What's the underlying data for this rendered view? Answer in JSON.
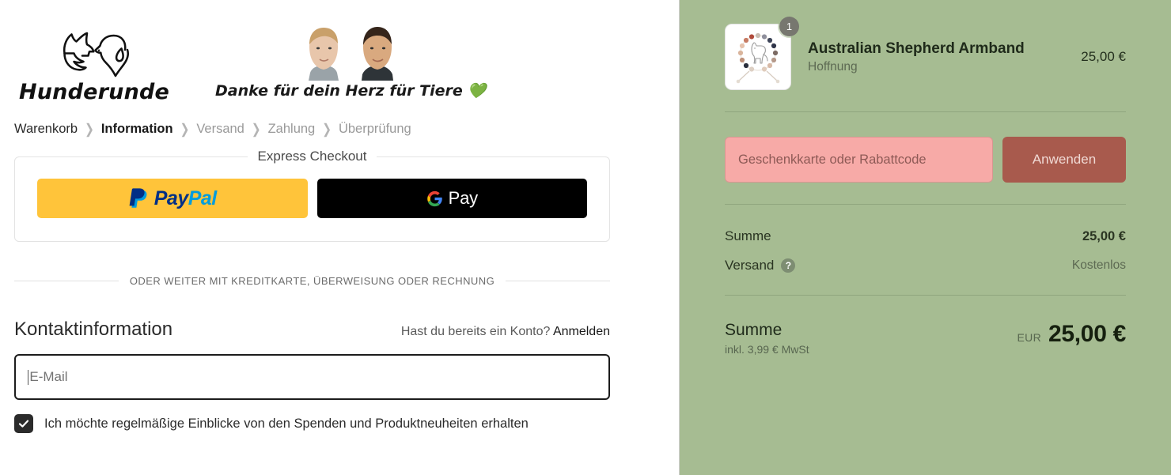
{
  "brand": {
    "logo_word": "Hunderunde",
    "logo_icon": "two-dog-heads-logo",
    "tagline": "Danke für dein Herz für Tiere",
    "tagline_heart": "💚"
  },
  "breadcrumb": {
    "items": [
      {
        "label": "Warenkorb",
        "state": "link"
      },
      {
        "label": "Information",
        "state": "current"
      },
      {
        "label": "Versand",
        "state": "upcoming"
      },
      {
        "label": "Zahlung",
        "state": "upcoming"
      },
      {
        "label": "Überprüfung",
        "state": "upcoming"
      }
    ],
    "separator": "❯"
  },
  "express": {
    "legend": "Express Checkout",
    "paypal": {
      "pay": "Pay",
      "pal": "Pal",
      "icon": "paypal-logo"
    },
    "gpay": {
      "label": "Pay",
      "icon": "google-g-logo"
    }
  },
  "divider": {
    "text": "ODER WEITER MIT KREDITKARTE, ÜBERWEISUNG ODER RECHNUNG"
  },
  "contact": {
    "title": "Kontaktinformation",
    "login_prompt": "Hast du bereits ein Konto?",
    "login_link": "Anmelden",
    "email_placeholder": "E-Mail",
    "email_value": "",
    "newsletter_label": "Ich möchte regelmäßige Einblicke von den Spenden und Produktneuheiten erhalten",
    "newsletter_checked": "true"
  },
  "summary": {
    "line_item": {
      "title": "Australian Shepherd Armband",
      "variant": "Hoffnung",
      "quantity": "1",
      "price": "25,00 €",
      "thumb_icon": "beaded-bracelet-dog-charm"
    },
    "discount": {
      "placeholder": "Geschenkkarte oder Rabattcode",
      "value": "",
      "apply_label": "Anwenden"
    },
    "totals": [
      {
        "label": "Summe",
        "value": "25,00 €",
        "muted": "false",
        "help": "false"
      },
      {
        "label": "Versand",
        "value": "Kostenlos",
        "muted": "true",
        "help": "true"
      }
    ],
    "grand": {
      "label": "Summe",
      "sub": "inkl. 3,99 € MwSt",
      "currency": "EUR",
      "amount": "25,00 €"
    }
  },
  "colors": {
    "sidebar_bg": "#a6bc92",
    "paypal_yellow": "#ffc43a",
    "gpay_black": "#000000",
    "discount_input_bg": "#f7aaa7",
    "apply_btn_bg": "#a85a4d",
    "heart_green": "#4caf50"
  }
}
